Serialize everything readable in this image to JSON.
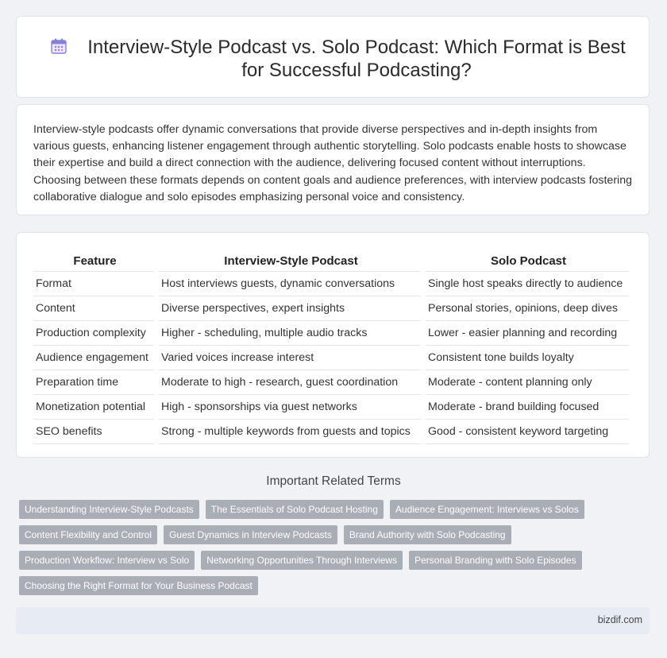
{
  "header": {
    "title": "Interview-Style Podcast vs. Solo Podcast: Which Format is Best for Successful Podcasting?",
    "icon": "calendar-icon",
    "icon_color": "#8b7fd8"
  },
  "intro": {
    "text": "Interview-style podcasts offer dynamic conversations that provide diverse perspectives and in-depth insights from various guests, enhancing listener engagement through authentic storytelling. Solo podcasts enable hosts to showcase their expertise and build a direct connection with the audience, delivering focused content without interruptions. Choosing between these formats depends on content goals and audience preferences, with interview podcasts fostering collaborative dialogue and solo episodes emphasizing personal voice and consistency."
  },
  "table": {
    "headers": [
      "Feature",
      "Interview-Style Podcast",
      "Solo Podcast"
    ],
    "rows": [
      [
        "Format",
        "Host interviews guests, dynamic conversations",
        "Single host speaks directly to audience"
      ],
      [
        "Content",
        "Diverse perspectives, expert insights",
        "Personal stories, opinions, deep dives"
      ],
      [
        "Production complexity",
        "Higher - scheduling, multiple audio tracks",
        "Lower - easier planning and recording"
      ],
      [
        "Audience engagement",
        "Varied voices increase interest",
        "Consistent tone builds loyalty"
      ],
      [
        "Preparation time",
        "Moderate to high - research, guest coordination",
        "Moderate - content planning only"
      ],
      [
        "Monetization potential",
        "High - sponsorships via guest networks",
        "Moderate - brand building focused"
      ],
      [
        "SEO benefits",
        "Strong - multiple keywords from guests and topics",
        "Good - consistent keyword targeting"
      ]
    ]
  },
  "related": {
    "title": "Important Related Terms",
    "tags": [
      [
        "Understanding Interview-Style Podcasts",
        "The Essentials of Solo Podcast Hosting",
        "Audience Engagement: Interviews vs Solos"
      ],
      [
        "Content Flexibility and Control",
        "Guest Dynamics in Interview Podcasts",
        "Brand Authority with Solo Podcasting"
      ],
      [
        "Production Workflow: Interview vs Solo",
        "Networking Opportunities Through Interviews",
        "Personal Branding with Solo Episodes"
      ],
      [
        "Choosing the Right Format for Your Business Podcast"
      ]
    ]
  },
  "footer": {
    "site": "bizdif.com"
  },
  "colors": {
    "background": "#f0f2f6",
    "tag_bg": "#a9adb6",
    "footer_bg": "#e6ebf4"
  }
}
